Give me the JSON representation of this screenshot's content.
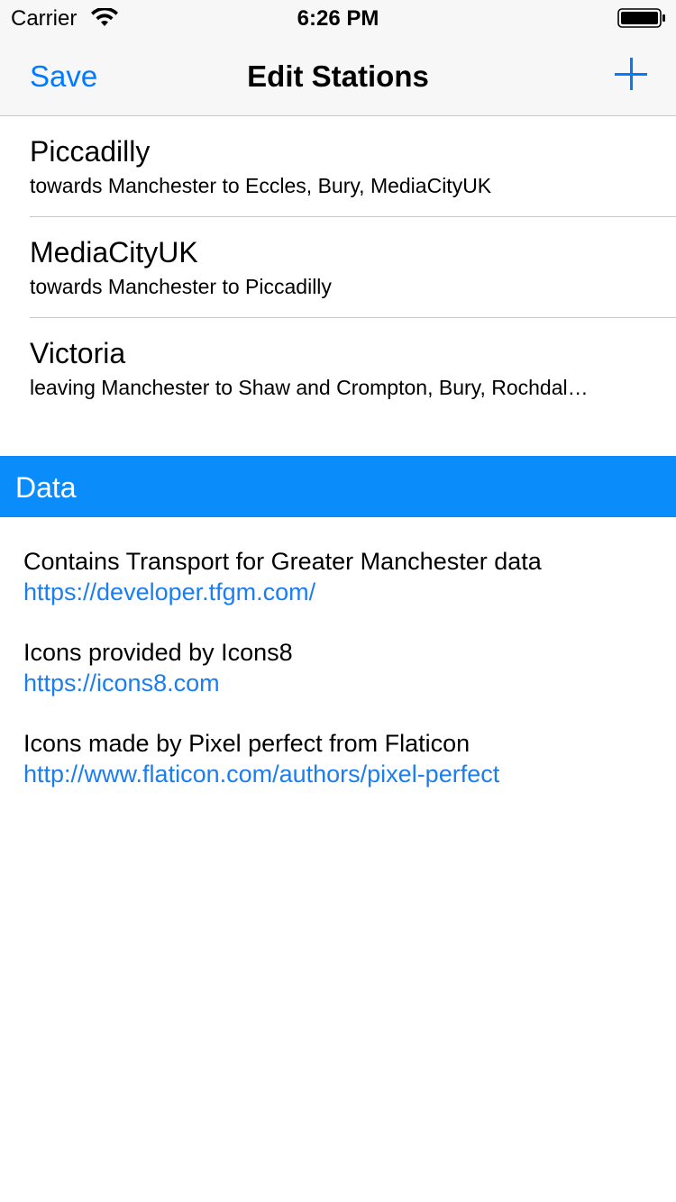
{
  "status_bar": {
    "carrier": "Carrier",
    "time": "6:26 PM",
    "icons": [
      "wifi-icon",
      "battery-icon"
    ]
  },
  "nav": {
    "save_label": "Save",
    "title": "Edit Stations",
    "add_icon": "plus-icon"
  },
  "stations": [
    {
      "name": "Piccadilly",
      "subtitle": "towards Manchester to Eccles, Bury, MediaCityUK"
    },
    {
      "name": "MediaCityUK",
      "subtitle": "towards Manchester to Piccadilly"
    },
    {
      "name": "Victoria",
      "subtitle": "leaving Manchester to Shaw and Crompton, Bury, Rochdal…"
    }
  ],
  "data_section": {
    "title": "Data",
    "credits": [
      {
        "text": "Contains Transport for Greater Manchester data",
        "link": "https://developer.tfgm.com/"
      },
      {
        "text": "Icons provided by Icons8",
        "link": "https://icons8.com"
      },
      {
        "text": "Icons made by Pixel perfect from Flaticon",
        "link": "http://www.flaticon.com/authors/pixel-perfect"
      }
    ]
  },
  "colors": {
    "accent": "#007aff",
    "section_header": "#0a8cfb",
    "link": "#1b7ef0",
    "separator": "#c8c7cc",
    "bar_background": "#f7f7f7"
  }
}
